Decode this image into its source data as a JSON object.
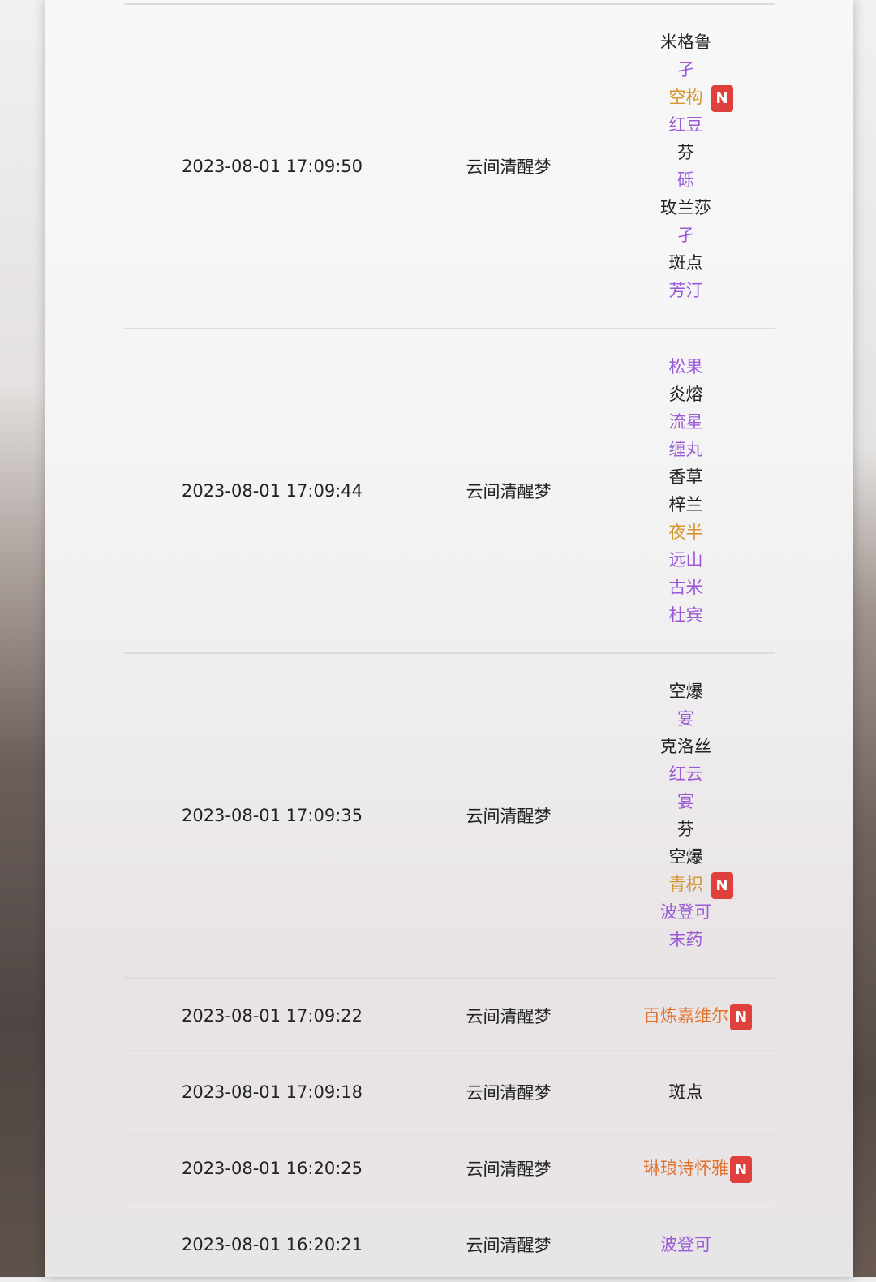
{
  "colors": {
    "star3": "#222222",
    "star4": "#9b59d6",
    "star5": "#d4952e",
    "star6": "#e2722b",
    "new_badge": "#e0403b"
  },
  "new_badge_label": "N",
  "rows": [
    {
      "time": "2023-08-01 17:09:50",
      "pool": "云间清醒梦",
      "ops": [
        {
          "name": "米格鲁",
          "color": "#222222",
          "new": false
        },
        {
          "name": "孑",
          "color": "#9b59d6",
          "new": false
        },
        {
          "name": "空构",
          "color": "#d4952e",
          "new": true
        },
        {
          "name": "红豆",
          "color": "#9b59d6",
          "new": false
        },
        {
          "name": "芬",
          "color": "#222222",
          "new": false
        },
        {
          "name": "砾",
          "color": "#9b59d6",
          "new": false
        },
        {
          "name": "玫兰莎",
          "color": "#222222",
          "new": false
        },
        {
          "name": "孑",
          "color": "#9b59d6",
          "new": false
        },
        {
          "name": "斑点",
          "color": "#222222",
          "new": false
        },
        {
          "name": "芳汀",
          "color": "#9b59d6",
          "new": false
        }
      ]
    },
    {
      "time": "2023-08-01 17:09:44",
      "pool": "云间清醒梦",
      "ops": [
        {
          "name": "松果",
          "color": "#9b59d6",
          "new": false
        },
        {
          "name": "炎熔",
          "color": "#222222",
          "new": false
        },
        {
          "name": "流星",
          "color": "#9b59d6",
          "new": false
        },
        {
          "name": "缠丸",
          "color": "#9b59d6",
          "new": false
        },
        {
          "name": "香草",
          "color": "#222222",
          "new": false
        },
        {
          "name": "梓兰",
          "color": "#222222",
          "new": false
        },
        {
          "name": "夜半",
          "color": "#d4952e",
          "new": false
        },
        {
          "name": "远山",
          "color": "#9b59d6",
          "new": false
        },
        {
          "name": "古米",
          "color": "#9b59d6",
          "new": false
        },
        {
          "name": "杜宾",
          "color": "#9b59d6",
          "new": false
        }
      ]
    },
    {
      "time": "2023-08-01 17:09:35",
      "pool": "云间清醒梦",
      "ops": [
        {
          "name": "空爆",
          "color": "#222222",
          "new": false
        },
        {
          "name": "宴",
          "color": "#9b59d6",
          "new": false
        },
        {
          "name": "克洛丝",
          "color": "#222222",
          "new": false
        },
        {
          "name": "红云",
          "color": "#9b59d6",
          "new": false
        },
        {
          "name": "宴",
          "color": "#9b59d6",
          "new": false
        },
        {
          "name": "芬",
          "color": "#222222",
          "new": false
        },
        {
          "name": "空爆",
          "color": "#222222",
          "new": false
        },
        {
          "name": "青枳",
          "color": "#d4952e",
          "new": true
        },
        {
          "name": "波登可",
          "color": "#9b59d6",
          "new": false
        },
        {
          "name": "末药",
          "color": "#9b59d6",
          "new": false
        }
      ]
    },
    {
      "time": "2023-08-01 17:09:22",
      "pool": "云间清醒梦",
      "ops": [
        {
          "name": "百炼嘉维尔",
          "color": "#e2722b",
          "new": true
        }
      ]
    },
    {
      "time": "2023-08-01 17:09:18",
      "pool": "云间清醒梦",
      "ops": [
        {
          "name": "斑点",
          "color": "#222222",
          "new": false
        }
      ]
    },
    {
      "time": "2023-08-01 16:20:25",
      "pool": "云间清醒梦",
      "ops": [
        {
          "name": "琳琅诗怀雅",
          "color": "#e2722b",
          "new": true
        }
      ]
    },
    {
      "time": "2023-08-01 16:20:21",
      "pool": "云间清醒梦",
      "ops": [
        {
          "name": "波登可",
          "color": "#9b59d6",
          "new": false
        }
      ]
    }
  ]
}
